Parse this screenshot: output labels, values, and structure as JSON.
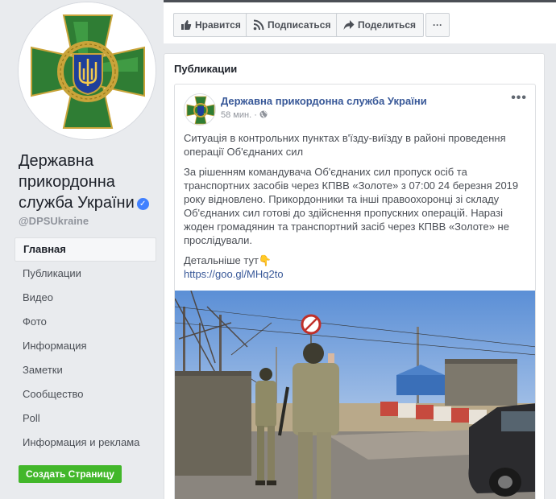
{
  "page": {
    "name": "Державна прикордонна служба України",
    "handle": "@DPSUkraine"
  },
  "actions": {
    "like": "Нравится",
    "subscribe": "Подписаться",
    "share": "Поделиться",
    "more": "···"
  },
  "sidebar": {
    "items": [
      {
        "label": "Главная"
      },
      {
        "label": "Публикации"
      },
      {
        "label": "Видео"
      },
      {
        "label": "Фото"
      },
      {
        "label": "Информация"
      },
      {
        "label": "Заметки"
      },
      {
        "label": "Сообщество"
      },
      {
        "label": "Poll"
      },
      {
        "label": "Информация и реклама"
      }
    ],
    "create_page": "Создать Страницу"
  },
  "publications": {
    "title": "Публикации",
    "post": {
      "author": "Державна прикордонна служба України",
      "time": "58 мин.",
      "more": "•••",
      "paragraph1": "Ситуація в контрольних пунктах в'їзду-виїзду в районі проведення операції Об'єднаних сил",
      "paragraph2": "За рішенням командувача Об'єднаних сил пропуск осіб та транспортних засобів через КПВВ «Золоте» з 07:00 24 березня 2019 року відновлено. Прикордонники та інші правоохоронці зі складу Об'єднаних сил готові до здійснення пропускних операцій. Наразі жоден громадянин та транспортний засіб через КПВВ «Золоте» не прослідували.",
      "details": "Детальніше тут👇",
      "link": "https://goo.gl/MHq2to"
    }
  },
  "colors": {
    "link": "#385898",
    "green_button": "#42b72a",
    "emblem_green": "#2e7d32",
    "emblem_gold": "#d4a017"
  }
}
